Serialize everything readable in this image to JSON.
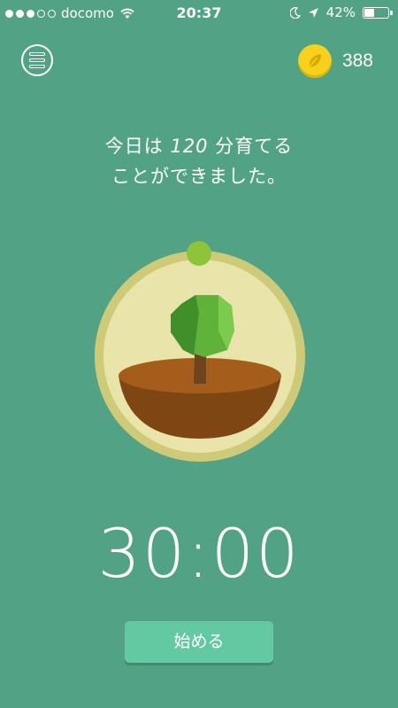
{
  "status_bar": {
    "carrier": "docomo",
    "time": "20:37",
    "battery": "42%",
    "battery_level": 0.42,
    "signal_bars_filled": 3,
    "signal_bars_total": 5
  },
  "header": {
    "menu_icon": "menu-icon",
    "coin_icon": "seed-coin-icon",
    "coin_count": "388"
  },
  "message": {
    "line1_prefix": "今日は",
    "line1_number": "120",
    "line1_suffix": "分育てる",
    "line2": "ことができました。"
  },
  "timer": {
    "value": "30:00"
  },
  "start_button": {
    "label": "始める"
  },
  "colors": {
    "background": "#52a385",
    "button": "#63c9a2",
    "coin": "#f6d21c",
    "ring": "#cfca78",
    "knob": "#8cc43a"
  }
}
